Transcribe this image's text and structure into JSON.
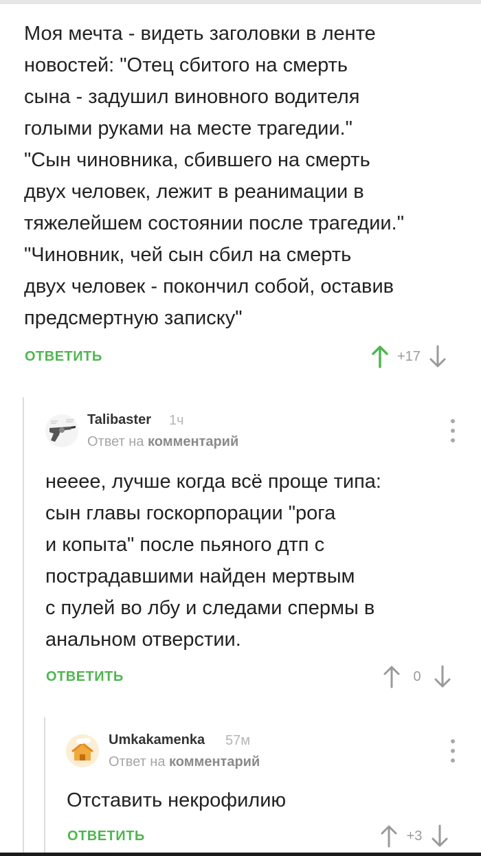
{
  "comments": [
    {
      "text": "Моя мечта - видеть заголовки в ленте\nновостей: \"Отец сбитого на смерть\nсына - задушил виновного водителя\nголыми руками на месте трагедии.\"\n\"Сын чиновника, сбившего на смерть\nдвух человек, лежит в реанимации в\nтяжелейшем состоянии после трагедии.\"\n\"Чиновник, чей сын сбил на смерть\nдвух человек - покончил собой, оставив\nпредсмертную записку\"",
      "reply_label": "ОТВЕТИТЬ",
      "rating": "+17",
      "upvoted": true
    },
    {
      "username": "Talibaster",
      "time": "1ч",
      "reply_to_prefix": "Ответ на",
      "reply_to_link": "комментарий",
      "avatar_icon": "revolver-icon",
      "text": "неееe, лучше когда всё проще типа:\nсын главы госкорпорации \"рога\nи копыта\" после пьяного дтп с\nпострадавшими найден мертвым\nс пулей во лбу и следами спермы в\nанальном отверстии.",
      "reply_label": "ОТВЕТИТЬ",
      "rating": "0",
      "upvoted": false
    },
    {
      "username": "Umkakamenka",
      "time": "57м",
      "reply_to_prefix": "Ответ на",
      "reply_to_link": "комментарий",
      "avatar_icon": "house-icon",
      "text": "Отставить некрофилию",
      "reply_label": "ОТВЕТИТЬ",
      "rating": "+3",
      "upvoted": false
    }
  ],
  "colors": {
    "accent_green": "#4fb64f",
    "muted": "#9a9a9a",
    "thread_line": "#dcdcdc"
  }
}
